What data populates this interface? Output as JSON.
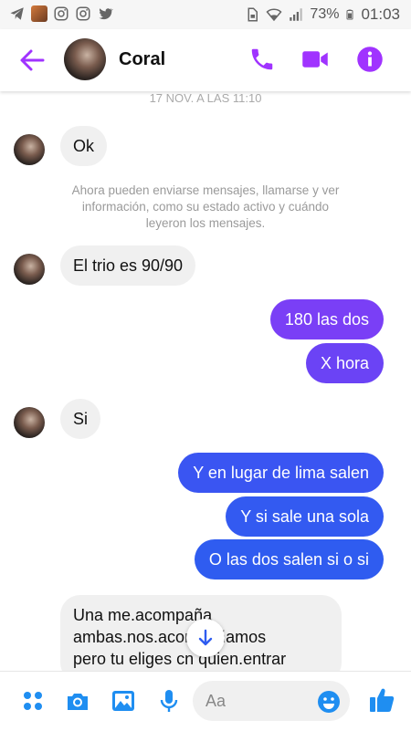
{
  "status_bar": {
    "battery": "73%",
    "time": "01:03"
  },
  "header": {
    "contact_name": "Coral"
  },
  "chat": {
    "timestamp": "17 NOV. A LAS 11:10",
    "system_message": "Ahora pueden enviarse mensajes, llamarse y ver información, como su estado activo y cuándo leyeron los mensajes.",
    "messages": [
      {
        "from": "them",
        "text": "Ok"
      },
      {
        "from": "them",
        "text": "El trio es 90/90"
      },
      {
        "from": "me",
        "text": "180 las dos"
      },
      {
        "from": "me",
        "text": "X hora"
      },
      {
        "from": "them",
        "text": "Si"
      },
      {
        "from": "me",
        "text": "Y en lugar de lima salen"
      },
      {
        "from": "me",
        "text": "Y si sale una sola"
      },
      {
        "from": "me",
        "text": "O las  dos salen si o si"
      },
      {
        "from": "them",
        "lines": [
          "Una me.acompaña",
          "ambas.nos.acompañamos",
          "pero tu eliges cn quien.entrar"
        ]
      }
    ]
  },
  "composer": {
    "placeholder": "Aa"
  },
  "colors": {
    "accent": "#a033ff",
    "bubble_purple": "#7a3ff6",
    "bubble_blue": "#2f5cf0",
    "incoming_bubble": "#f0f0f0"
  },
  "icons": [
    "telegram-icon",
    "gallery-thumbnail-icon",
    "instagram-icon",
    "instagram-icon",
    "twitter-icon",
    "sim-icon",
    "wifi-icon",
    "signal-icon",
    "battery-icon",
    "back-arrow-icon",
    "phone-icon",
    "video-icon",
    "info-icon",
    "menu-dots-icon",
    "camera-icon",
    "image-icon",
    "microphone-icon",
    "emoji-icon",
    "thumbs-up-icon",
    "arrow-down-icon"
  ]
}
